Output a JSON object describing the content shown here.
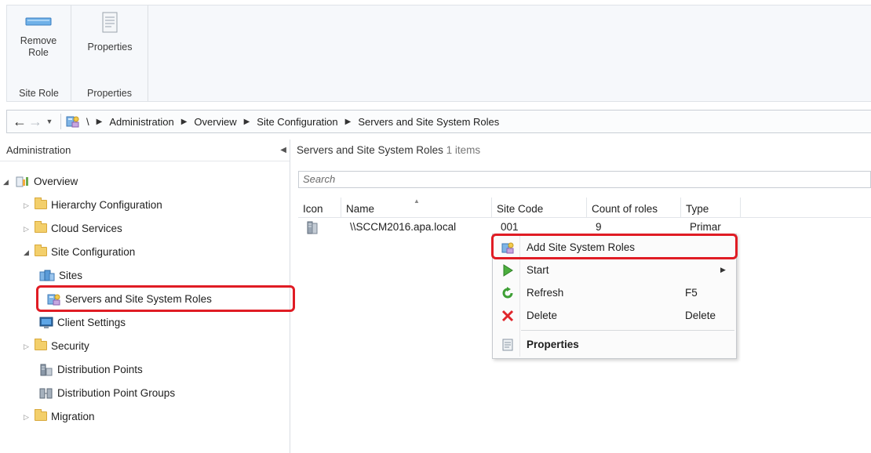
{
  "ribbon": {
    "groups": [
      {
        "label": "Site Role",
        "button_label_line1": "Remove",
        "button_label_line2": "Role"
      },
      {
        "label": "Properties",
        "button_label_line1": "Properties"
      }
    ]
  },
  "address_bar": {
    "root": "\\",
    "crumbs": [
      "Administration",
      "Overview",
      "Site Configuration",
      "Servers and Site System Roles"
    ]
  },
  "left_pane": {
    "title": "Administration",
    "tree": [
      {
        "label": "Overview",
        "expanded": true,
        "icon": "overview-icon"
      },
      {
        "label": "Hierarchy Configuration",
        "icon": "folder-icon"
      },
      {
        "label": "Cloud Services",
        "icon": "folder-icon"
      },
      {
        "label": "Site Configuration",
        "expanded": true,
        "icon": "folder-icon"
      },
      {
        "label": "Sites",
        "icon": "sites-icon"
      },
      {
        "label": "Servers and Site System Roles",
        "icon": "server-roles-icon",
        "selected": true
      },
      {
        "label": "Client Settings",
        "icon": "client-settings-icon"
      },
      {
        "label": "Security",
        "icon": "folder-icon"
      },
      {
        "label": "Distribution Points",
        "icon": "distribution-point-icon"
      },
      {
        "label": "Distribution Point Groups",
        "icon": "distribution-group-icon"
      },
      {
        "label": "Migration",
        "icon": "folder-icon"
      }
    ]
  },
  "right_pane": {
    "title": "Servers and Site System Roles",
    "count": "1 items",
    "search_placeholder": "Search",
    "columns": [
      "Icon",
      "Name",
      "Site Code",
      "Count of roles",
      "Type"
    ],
    "rows": [
      {
        "name": "\\\\SCCM2016.apa.local",
        "site_code": "001",
        "count_of_roles": "9",
        "type": "Primar"
      }
    ]
  },
  "context_menu": {
    "items": [
      {
        "label": "Add Site System Roles",
        "icon": "add-roles-icon",
        "highlighted": true
      },
      {
        "label": "Start",
        "icon": "start-icon",
        "submenu": true
      },
      {
        "label": "Refresh",
        "icon": "refresh-icon",
        "shortcut": "F5"
      },
      {
        "label": "Delete",
        "icon": "delete-icon",
        "shortcut": "Delete"
      },
      {
        "label": "Properties",
        "icon": "properties-icon",
        "bold": true
      }
    ]
  },
  "colors": {
    "highlight_border": "#e01c24",
    "folder": "#f3cf6b",
    "ribbon_bg": "#f6f8fb"
  }
}
